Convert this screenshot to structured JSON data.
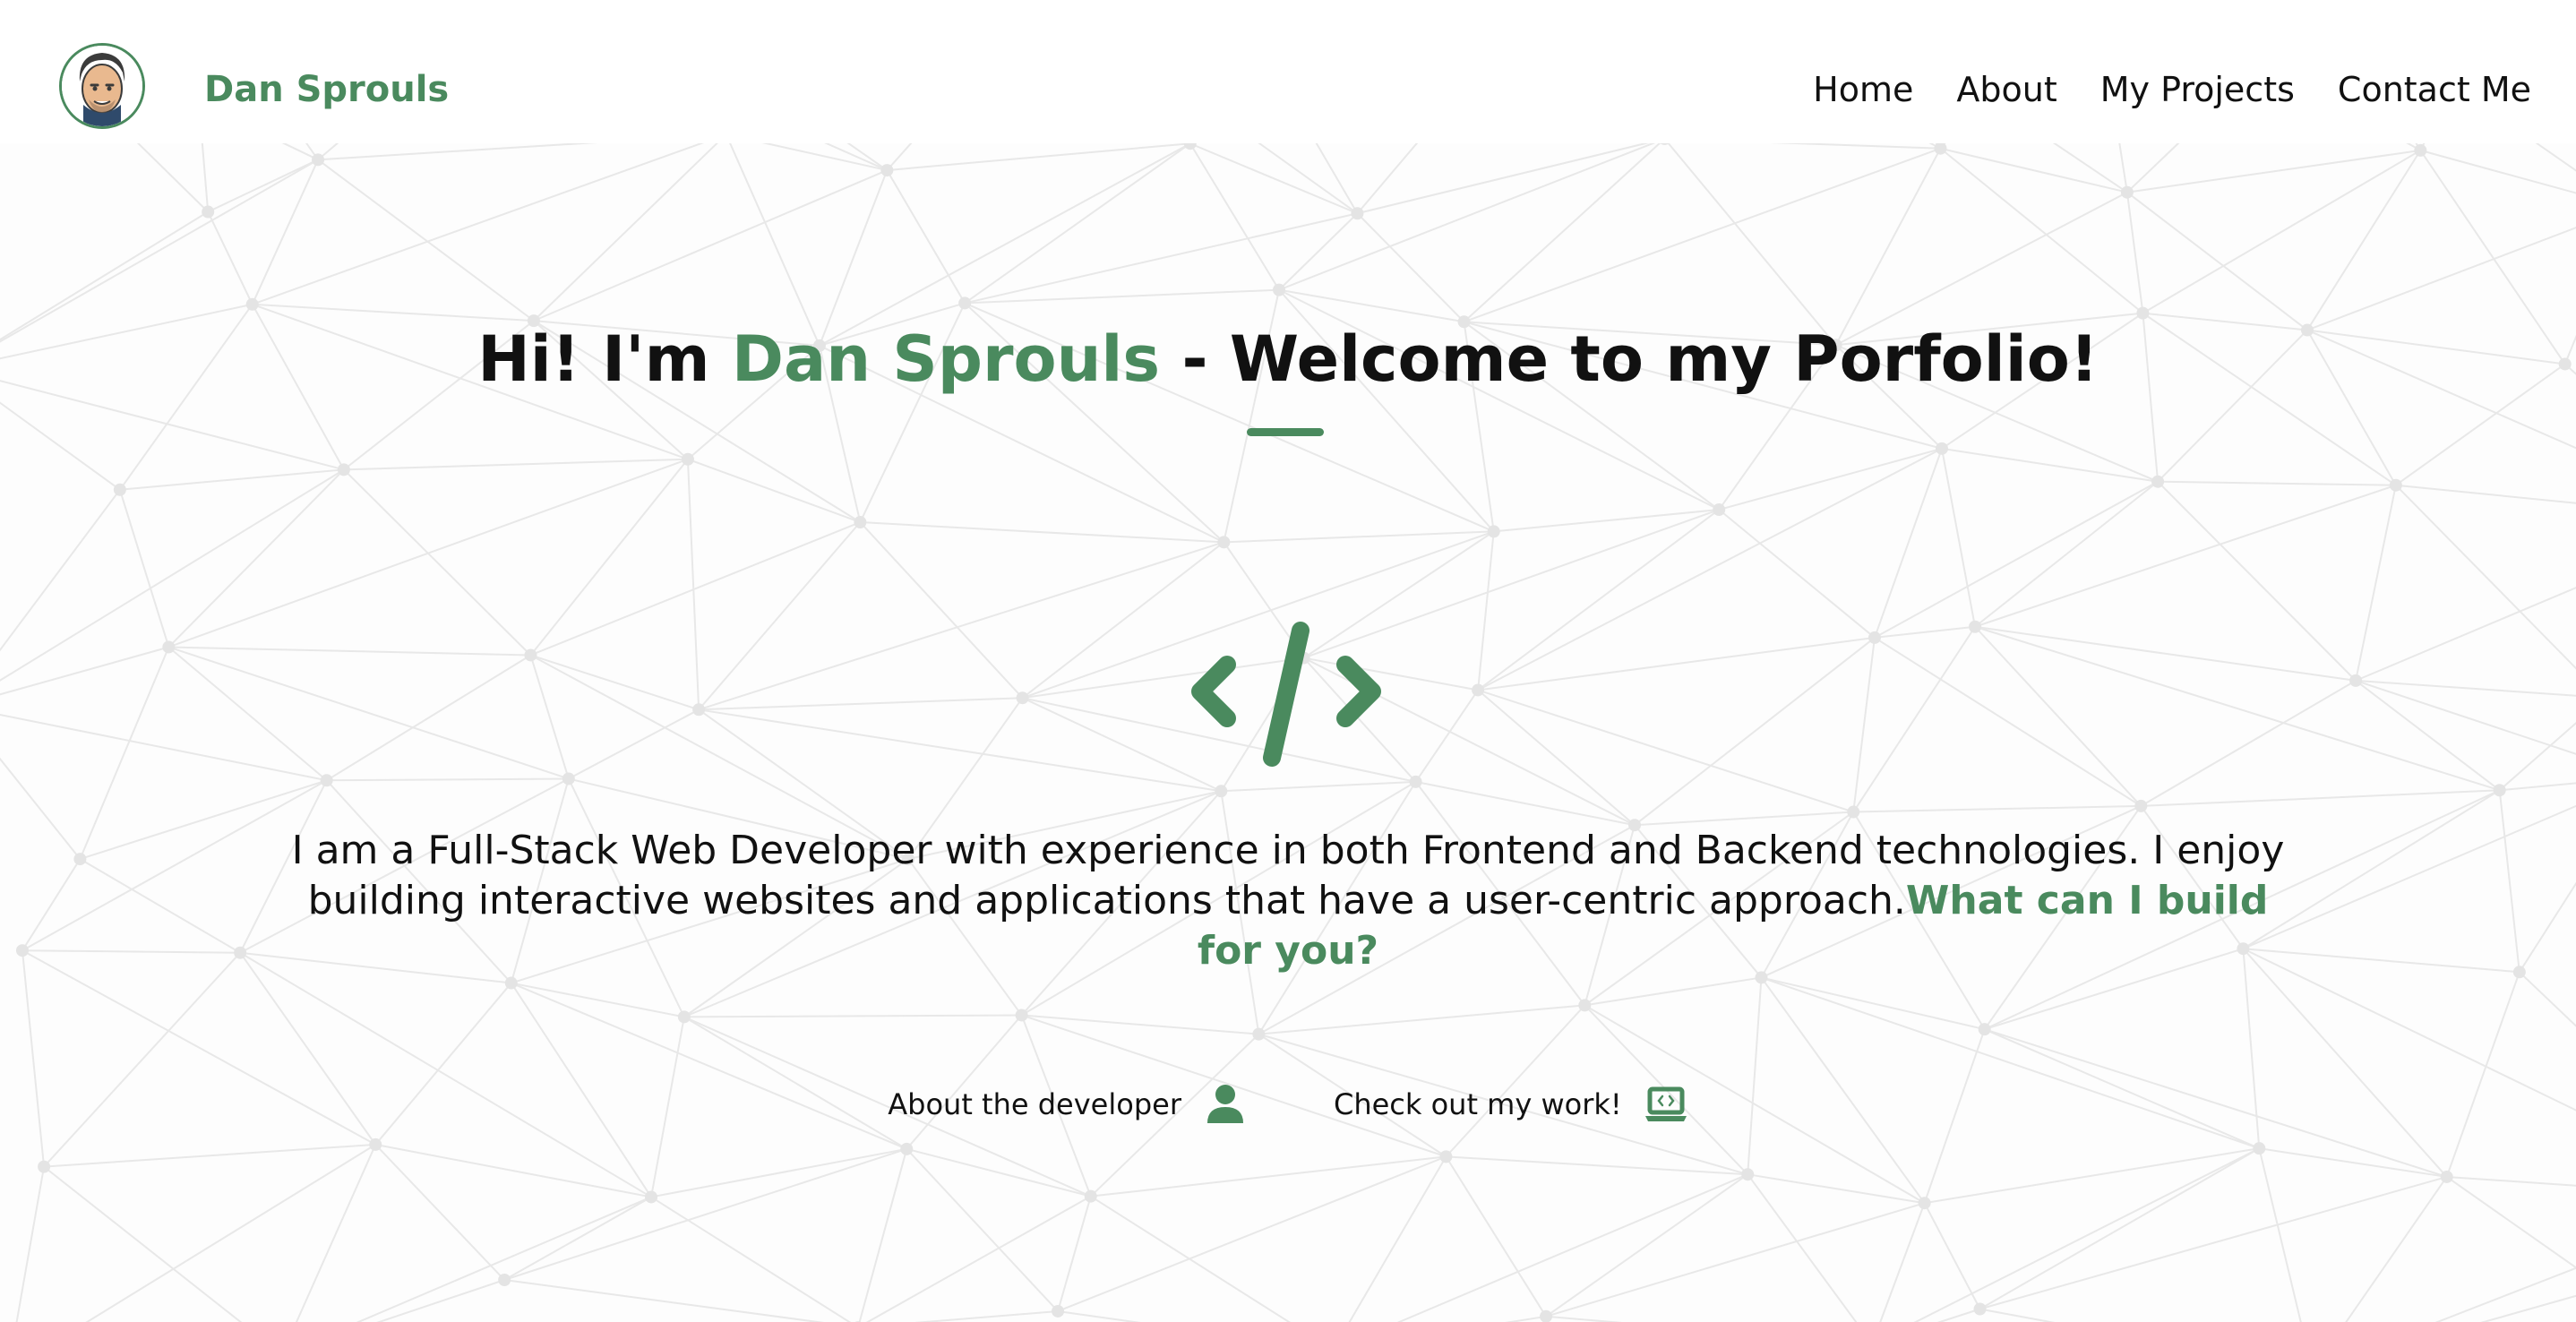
{
  "header": {
    "brand": "Dan Sprouls",
    "nav": [
      "Home",
      "About",
      "My Projects",
      "Contact Me"
    ]
  },
  "hero": {
    "title_prefix": "Hi! I'm ",
    "title_name": "Dan Sprouls",
    "title_suffix": " - Welcome to my Porfolio!",
    "intro_text": "I am a Full-Stack Web Developer with experience in both Frontend and Backend technologies. I enjoy building interactive websites and applications that have a user-centric approach.",
    "intro_cta": "What can I build for you?"
  },
  "actions": {
    "about_label": "About the developer",
    "about_icon": "user-icon",
    "work_label": "Check out my work!",
    "work_icon": "laptop-code-icon"
  },
  "icons": {
    "hero_icon": "code-icon"
  },
  "colors": {
    "accent": "#4a8a5e",
    "text": "#111111",
    "background": "#fdfdfd"
  }
}
